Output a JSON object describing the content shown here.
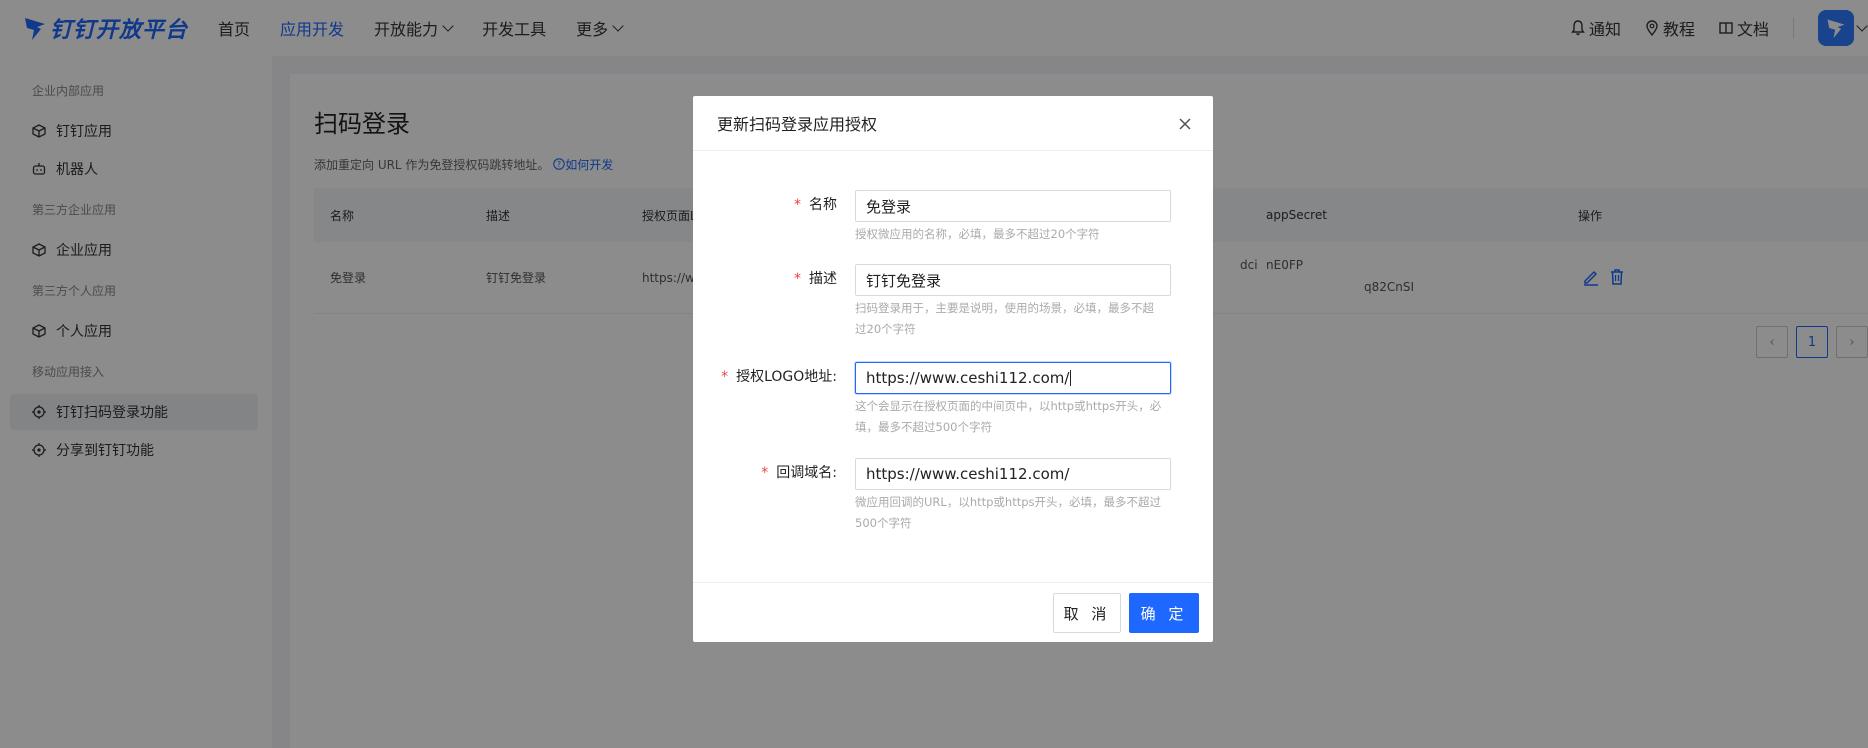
{
  "topnav": {
    "brand": "钉钉开放平台",
    "items": [
      {
        "label": "首页"
      },
      {
        "label": "应用开发"
      },
      {
        "label": "开放能力"
      },
      {
        "label": "开发工具"
      },
      {
        "label": "更多"
      }
    ],
    "right": {
      "notify": "通知",
      "tutorial": "教程",
      "docs": "文档"
    }
  },
  "sidebar": {
    "group1": "企业内部应用",
    "g1_items": [
      "钉钉应用",
      "机器人"
    ],
    "group2": "第三方企业应用",
    "g2_items": [
      "企业应用"
    ],
    "group3": "第三方个人应用",
    "g3_items": [
      "个人应用"
    ],
    "group4": "移动应用接入",
    "g4_items": [
      "钉钉扫码登录功能",
      "分享到钉钉功能"
    ]
  },
  "main": {
    "title": "扫码登录",
    "desc": "添加重定向 URL 作为免登授权码跳转地址。",
    "desc_link": "如何开发",
    "columns": [
      "名称",
      "描述",
      "授权页面L",
      "appSecret",
      "操作"
    ],
    "row": {
      "name": "免登录",
      "desc": "钉钉免登录",
      "url": "https://w",
      "mid_partial": "dci",
      "secret_line1": "nE0FP",
      "secret_line2": "q82CnSI"
    },
    "pager": {
      "current": "1"
    }
  },
  "modal": {
    "title": "更新扫码登录应用授权",
    "fields": {
      "name": {
        "label": "名称",
        "value": "免登录",
        "hint": "授权微应用的名称，必填，最多不超过20个字符"
      },
      "desc": {
        "label": "描述",
        "value": "钉钉免登录",
        "hint1": "扫码登录用于，主要是说明，使用的场景，必填，最多不超",
        "hint2": "过20个字符"
      },
      "logo": {
        "label": "授权LOGO地址:",
        "value": "https://www.ceshi112.com/",
        "hint1": "这个会显示在授权页面的中间页中，以http或https开头，必",
        "hint2": "填，最多不超过500个字符"
      },
      "callback": {
        "label": "回调域名:",
        "value": "https://www.ceshi112.com/",
        "hint1": "微应用回调的URL，以http或https开头，必填，最多不超过",
        "hint2": "500个字符"
      }
    },
    "cancel": "取 消",
    "ok": "确 定"
  }
}
